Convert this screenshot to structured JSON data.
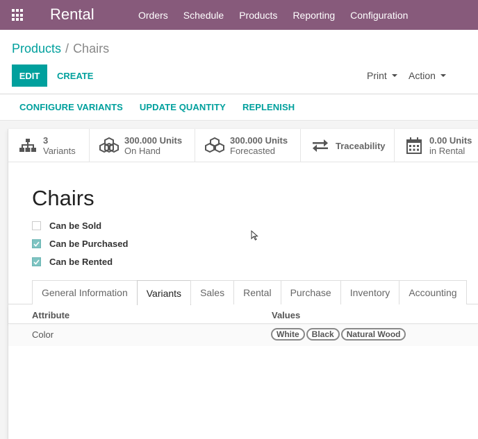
{
  "nav": {
    "app_title": "Rental",
    "menu": [
      "Orders",
      "Schedule",
      "Products",
      "Reporting",
      "Configuration"
    ]
  },
  "breadcrumb": {
    "parent": "Products",
    "separator": "/",
    "current": "Chairs"
  },
  "actions": {
    "edit": "EDIT",
    "create": "CREATE",
    "print": "Print",
    "action": "Action"
  },
  "header_buttons": [
    "CONFIGURE VARIANTS",
    "UPDATE QUANTITY",
    "REPLENISH"
  ],
  "stats": [
    {
      "icon": "sitemap-icon",
      "value": "3",
      "label": "Variants"
    },
    {
      "icon": "cubes-icon",
      "value": "300.000 Units",
      "label": "On Hand"
    },
    {
      "icon": "cubes-icon",
      "value": "300.000 Units",
      "label": "Forecasted"
    },
    {
      "icon": "exchange-icon",
      "value": "",
      "label": "Traceability"
    },
    {
      "icon": "calendar-icon",
      "value": "0.00 Units",
      "label": "in Rental"
    }
  ],
  "product": {
    "name": "Chairs",
    "checks": [
      {
        "label": "Can be Sold",
        "checked": false
      },
      {
        "label": "Can be Purchased",
        "checked": true
      },
      {
        "label": "Can be Rented",
        "checked": true
      }
    ]
  },
  "tabs": [
    "General Information",
    "Variants",
    "Sales",
    "Rental",
    "Purchase",
    "Inventory",
    "Accounting"
  ],
  "active_tab": "Variants",
  "variants_table": {
    "headers": [
      "Attribute",
      "Values"
    ],
    "rows": [
      {
        "attribute": "Color",
        "values": [
          "White",
          "Black",
          "Natural Wood"
        ]
      }
    ]
  },
  "colors": {
    "brand": "#875a7b",
    "accent": "#00a09d"
  }
}
